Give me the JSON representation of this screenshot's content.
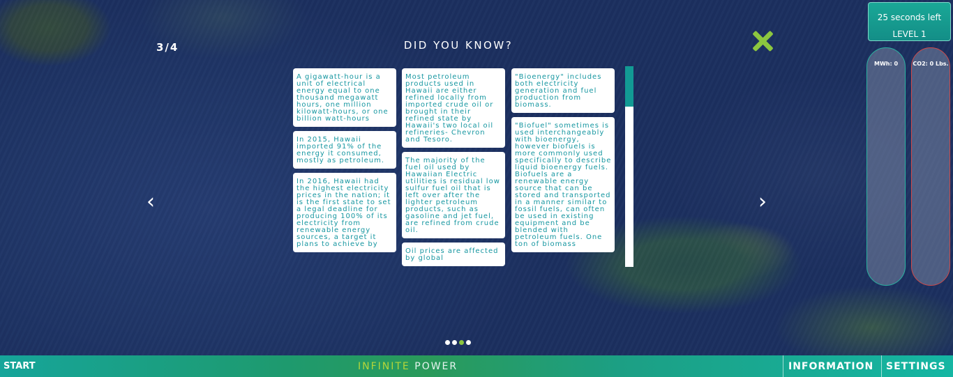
{
  "slide": {
    "counter": "3/4",
    "title": "DID YOU KNOW?"
  },
  "nav": {
    "prev": "‹",
    "next": "›"
  },
  "columns": [
    [
      "A gigawatt-hour is a unit of electrical energy equal to one thousand megawatt hours, one million kilowatt-hours, or one billion watt-hours",
      "In 2015, Hawaii imported 91% of the energy it consumed, mostly as petroleum.",
      "In 2016, Hawaii had the highest electricity prices in the nation; it is the first state to set a legal deadline for producing 100% of its electricity from renewable energy sources, a target it plans to achieve by"
    ],
    [
      "Most petroleum products used in Hawaii are either refined locally from imported crude oil or brought in their refined state by Hawaii's two local oil refineries- Chevron and Tesoro.",
      "The majority of the fuel oil used by Hawaiian Electric utilities is residual low sulfur fuel oil that is left over after the lighter petroleum products, such as gasoline and jet fuel, are refined from crude oil.",
      "Oil prices are affected by global"
    ],
    [
      "\"Bioenergy\" includes both electricity generation and fuel production from biomass.",
      "\"Biofuel\" sometimes is used interchangeably with bioenergy, however biofuels is more commonly used specifically to describe liquid bioenergy fuels. Biofuels are a renewable energy source that can be stored and transported in a manner similar to fossil fuels, can often be used in existing equipment and be blended with petroleum fuels. One ton of biomass"
    ]
  ],
  "pagination": {
    "count": 4,
    "active_index": 2
  },
  "hud": {
    "timer": "25 seconds left",
    "level": "LEVEL 1",
    "mwh": "MWh: 0",
    "co2": "CO2: 0 Lbs."
  },
  "bottombar": {
    "start": "START",
    "brand_a": "INFINITE",
    "brand_b": "POWER",
    "information": "INFORMATION",
    "settings": "SETTINGS"
  },
  "colors": {
    "accent_green": "#8cc63f",
    "card_text": "#1596a0",
    "scroll_thumb": "#129a94"
  }
}
